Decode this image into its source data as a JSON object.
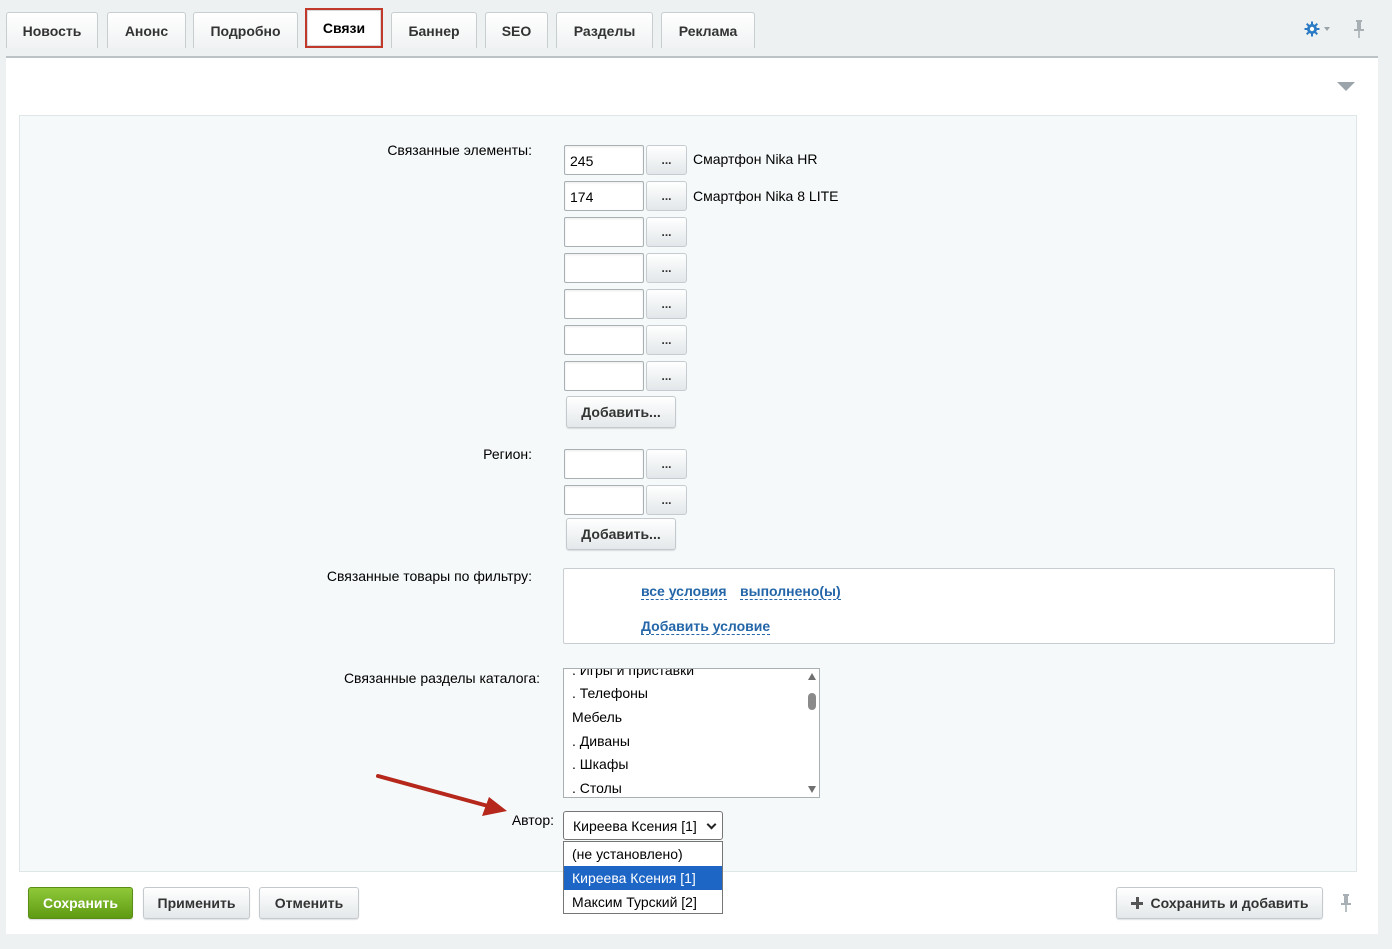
{
  "tabs": [
    {
      "label": "Новость"
    },
    {
      "label": "Анонс"
    },
    {
      "label": "Подробно"
    },
    {
      "label": "Связи"
    },
    {
      "label": "Баннер"
    },
    {
      "label": "SEO"
    },
    {
      "label": "Разделы"
    },
    {
      "label": "Реклама"
    }
  ],
  "active_tab": "Связи",
  "colors": {
    "accent": "#c0392b",
    "link": "#2466a8",
    "save": "#6aa61c",
    "selection": "#1e66c6"
  },
  "fields": {
    "related_elements": {
      "label": "Связанные элементы:",
      "rows": [
        {
          "value": "245",
          "name": "Смартфон Nika HR"
        },
        {
          "value": "174",
          "name": "Смартфон Nika 8 LITE"
        },
        {
          "value": "",
          "name": ""
        },
        {
          "value": "",
          "name": ""
        },
        {
          "value": "",
          "name": ""
        },
        {
          "value": "",
          "name": ""
        },
        {
          "value": "",
          "name": ""
        }
      ],
      "add_label": "Добавить..."
    },
    "region": {
      "label": "Регион:",
      "rows": [
        {
          "value": ""
        },
        {
          "value": ""
        }
      ],
      "add_label": "Добавить..."
    },
    "filter": {
      "label": "Связанные товары по фильтру:",
      "all_conditions": "все условия",
      "fulfilled": "выполнено(ы)",
      "add_condition": "Добавить условие"
    },
    "catalog_sections": {
      "label": "Связанные разделы каталога:",
      "options": [
        ". Игры и приставки",
        ". Телефоны",
        "Мебель",
        ". Диваны",
        ". Шкафы",
        ". Столы"
      ]
    },
    "author": {
      "label": "Автор:",
      "selected": "Киреева Ксения [1]",
      "options": [
        "(не установлено)",
        "Киреева Ксения [1]",
        "Максим Турский [2]"
      ],
      "highlighted_index": 1
    }
  },
  "dots_label": "...",
  "footer": {
    "save": "Сохранить",
    "apply": "Применить",
    "cancel": "Отменить",
    "save_and_add": "Сохранить и добавить"
  },
  "icons": [
    "gear-icon",
    "pin-icon",
    "collapse-arrow-icon",
    "plus-icon",
    "annotation-arrow"
  ]
}
